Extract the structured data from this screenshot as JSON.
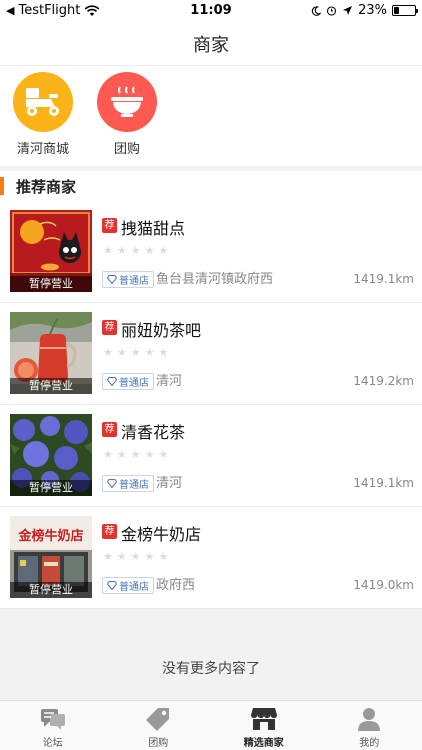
{
  "status_bar": {
    "carrier": "TestFlight",
    "time": "11:09",
    "battery_percent": "23%",
    "battery_level": 0.23
  },
  "nav": {
    "title": "商家"
  },
  "quick_entries": [
    {
      "label": "清河商城",
      "icon": "delivery-scooter-icon",
      "color": "#fbb417"
    },
    {
      "label": "团购",
      "icon": "bowl-icon",
      "color": "#ff5a52"
    }
  ],
  "section": {
    "title": "推荐商家"
  },
  "badges": {
    "recommend": "荐",
    "tier": "普通店",
    "closed": "暂停营业"
  },
  "shops": [
    {
      "name": "拽猫甜点",
      "address": "鱼台县清河镇政府西",
      "distance": "1419.1km",
      "rating": 0
    },
    {
      "name": "丽妞奶茶吧",
      "address": "清河",
      "distance": "1419.2km",
      "rating": 0
    },
    {
      "name": "清香花茶",
      "address": "清河",
      "distance": "1419.1km",
      "rating": 0
    },
    {
      "name": "金榜牛奶店",
      "address": "政府西",
      "distance": "1419.0km",
      "rating": 0
    }
  ],
  "shop_sign_text": "金榜牛奶店",
  "footer": {
    "no_more": "没有更多内容了"
  },
  "tabs": [
    {
      "label": "论坛",
      "icon": "chat-bubbles-icon",
      "active": false
    },
    {
      "label": "团购",
      "icon": "tag-icon",
      "active": false
    },
    {
      "label": "精选商家",
      "icon": "storefront-icon",
      "active": true
    },
    {
      "label": "我的",
      "icon": "person-icon",
      "active": false
    }
  ]
}
